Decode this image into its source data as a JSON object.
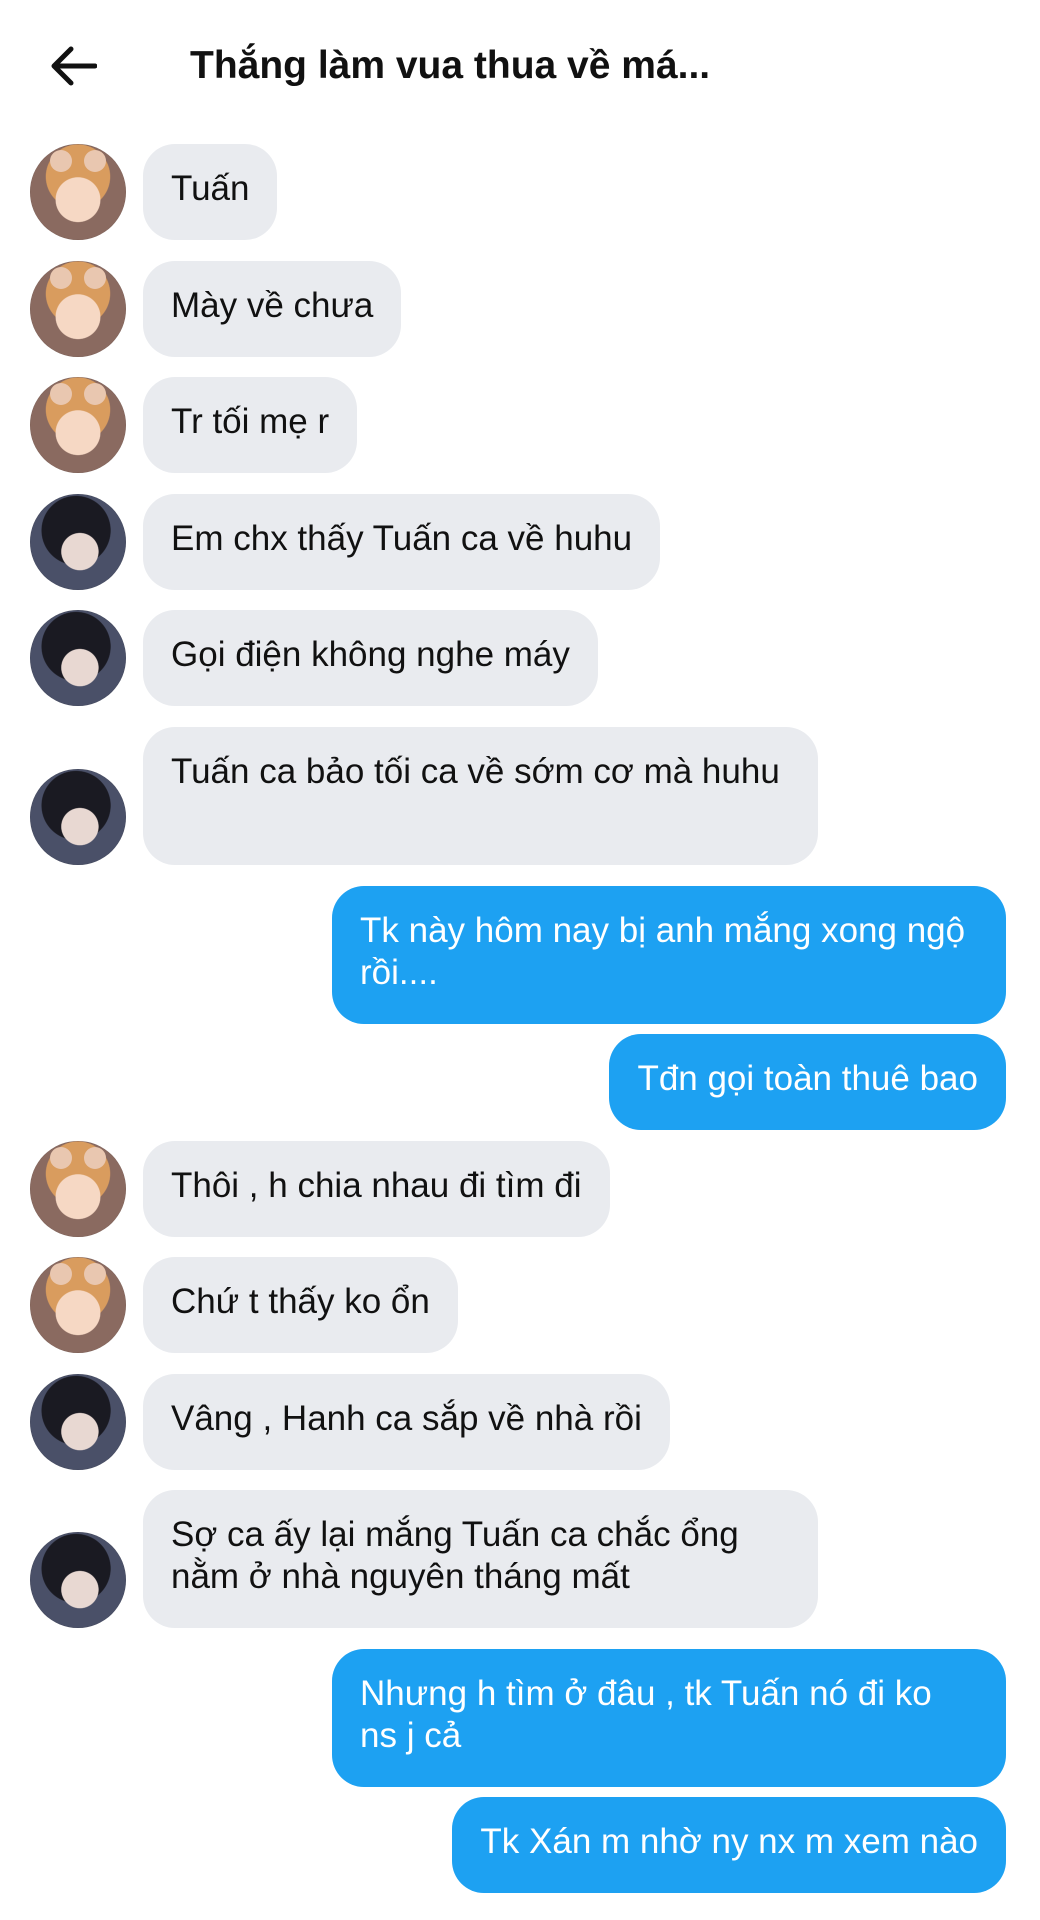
{
  "header": {
    "back_icon": "arrow-left-icon",
    "title": "Thắng làm vua thua về má..."
  },
  "colors": {
    "incoming_bubble": "#e9ebef",
    "outgoing_bubble": "#1da1f2"
  },
  "messages": [
    {
      "sender": "a",
      "direction": "in",
      "text": "Tuấn"
    },
    {
      "sender": "a",
      "direction": "in",
      "text": "Mày về chưa"
    },
    {
      "sender": "a",
      "direction": "in",
      "text": "Tr tối mẹ r"
    },
    {
      "sender": "b",
      "direction": "in",
      "text": "Em chx thấy Tuấn ca về huhu"
    },
    {
      "sender": "b",
      "direction": "in",
      "text": "Gọi điện không nghe máy"
    },
    {
      "sender": "b",
      "direction": "in",
      "text": "Tuấn ca bảo tối ca về sớm cơ mà huhu"
    },
    {
      "sender": "me",
      "direction": "out",
      "text": "Tk này hôm nay bị anh mắng xong ngộ rồi...."
    },
    {
      "sender": "me",
      "direction": "out",
      "text": "Tđn gọi toàn thuê bao"
    },
    {
      "sender": "a",
      "direction": "in",
      "text": "Thôi , h chia nhau đi tìm đi"
    },
    {
      "sender": "a",
      "direction": "in",
      "text": "Chứ t thấy ko ổn"
    },
    {
      "sender": "b",
      "direction": "in",
      "text": "Vâng , Hanh ca sắp về nhà rồi"
    },
    {
      "sender": "b",
      "direction": "in",
      "text": "Sợ ca ấy lại mắng Tuấn ca chắc ổng nằm ở nhà nguyên tháng mất"
    },
    {
      "sender": "me",
      "direction": "out",
      "text": "Nhưng h tìm ở đâu , tk Tuấn nó đi ko ns j cả"
    },
    {
      "sender": "me",
      "direction": "out",
      "text": "Tk Xán m nhờ ny nx m xem nào"
    }
  ]
}
